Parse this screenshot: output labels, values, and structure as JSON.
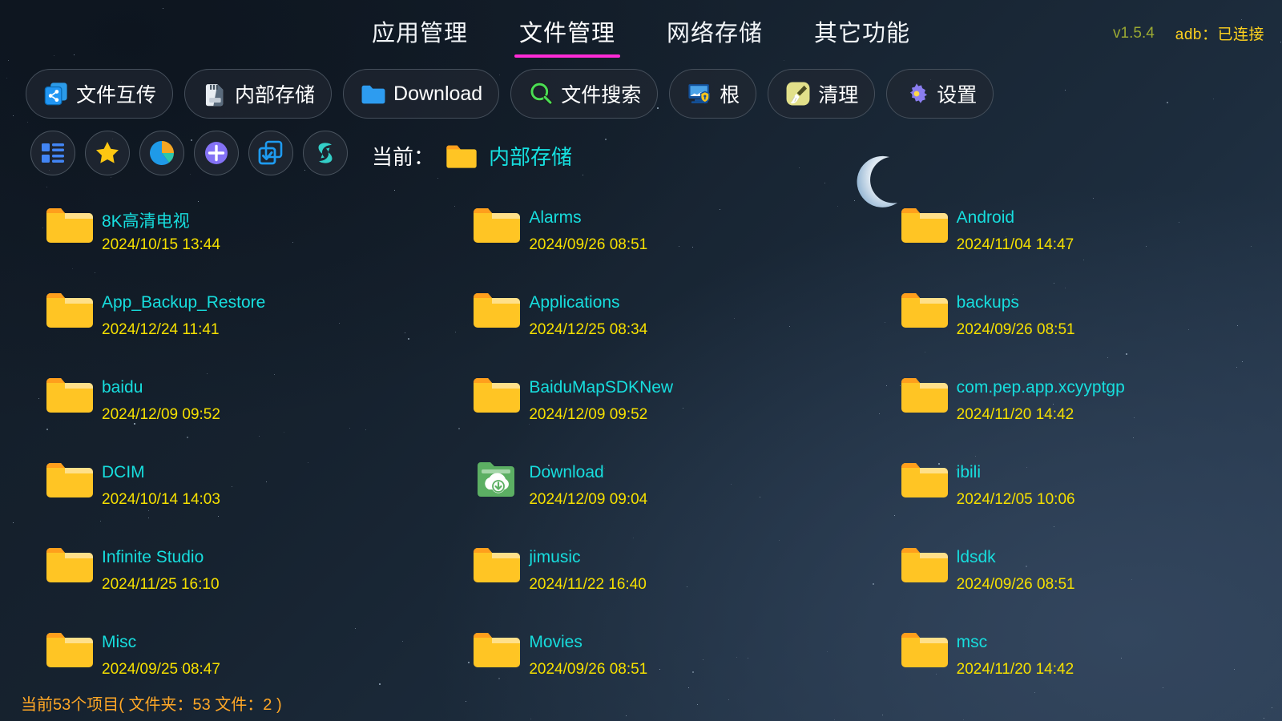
{
  "header": {
    "nav": [
      {
        "label": "应用管理",
        "active": false
      },
      {
        "label": "文件管理",
        "active": true
      },
      {
        "label": "网络存储",
        "active": false
      },
      {
        "label": "其它功能",
        "active": false
      }
    ],
    "version": "v1.5.4",
    "adb_status": "adb：已连接",
    "accent_underline": "#ff2bd6",
    "version_color": "#9aa832",
    "adb_color": "#ffd21e"
  },
  "toolbar": [
    {
      "label": "文件互传",
      "icon": "file-transfer-icon"
    },
    {
      "label": "内部存储",
      "icon": "sdcard-icon"
    },
    {
      "label": "Download",
      "icon": "folder-blue-icon"
    },
    {
      "label": "文件搜索",
      "icon": "search-green-icon"
    },
    {
      "label": "根",
      "icon": "root-monitor-shield-icon"
    },
    {
      "label": "清理",
      "icon": "broom-clean-icon"
    },
    {
      "label": "设置",
      "icon": "gear-icon"
    }
  ],
  "round_buttons": [
    {
      "name": "list-view-icon",
      "title": "列表视图"
    },
    {
      "name": "star-favorites-icon",
      "title": "收藏"
    },
    {
      "name": "pie-chart-storage-icon",
      "title": "存储分析"
    },
    {
      "name": "add-new-icon",
      "title": "新建"
    },
    {
      "name": "multi-select-icon",
      "title": "多选"
    },
    {
      "name": "refresh-sync-icon",
      "title": "刷新"
    }
  ],
  "breadcrumb": {
    "label": "当前：",
    "path": "内部存储",
    "path_color": "#16e0e0"
  },
  "files": [
    {
      "name": "8K高清电视",
      "date": "2024/10/15 13:44",
      "type": "folder"
    },
    {
      "name": "Alarms",
      "date": "2024/09/26 08:51",
      "type": "folder"
    },
    {
      "name": "Android",
      "date": "2024/11/04 14:47",
      "type": "folder"
    },
    {
      "name": "App_Backup_Restore",
      "date": "2024/12/24 11:41",
      "type": "folder"
    },
    {
      "name": "Applications",
      "date": "2024/12/25 08:34",
      "type": "folder"
    },
    {
      "name": "backups",
      "date": "2024/09/26 08:51",
      "type": "folder"
    },
    {
      "name": "baidu",
      "date": "2024/12/09 09:52",
      "type": "folder"
    },
    {
      "name": "BaiduMapSDKNew",
      "date": "2024/12/09 09:52",
      "type": "folder"
    },
    {
      "name": "com.pep.app.xcyyptgp",
      "date": "2024/11/20 14:42",
      "type": "folder"
    },
    {
      "name": "DCIM",
      "date": "2024/10/14 14:03",
      "type": "folder"
    },
    {
      "name": "Download",
      "date": "2024/12/09 09:04",
      "type": "folder-download"
    },
    {
      "name": "ibili",
      "date": "2024/12/05 10:06",
      "type": "folder"
    },
    {
      "name": "Infinite Studio",
      "date": "2024/11/25 16:10",
      "type": "folder"
    },
    {
      "name": "jimusic",
      "date": "2024/11/22 16:40",
      "type": "folder"
    },
    {
      "name": "ldsdk",
      "date": "2024/09/26 08:51",
      "type": "folder"
    },
    {
      "name": "Misc",
      "date": "2024/09/25 08:47",
      "type": "folder"
    },
    {
      "name": "Movies",
      "date": "2024/09/26 08:51",
      "type": "folder"
    },
    {
      "name": "msc",
      "date": "2024/11/20 14:42",
      "type": "folder"
    }
  ],
  "statusbar": {
    "text": "当前53个项目( 文件夹：53  文件：2 )",
    "color": "#ffa726"
  },
  "colors": {
    "folder_yellow": "#ffc524",
    "folder_tab_orange": "#ff9f1c",
    "name_cyan": "#17dede",
    "date_yellow": "#f6e000",
    "download_green": "#5caf63"
  }
}
